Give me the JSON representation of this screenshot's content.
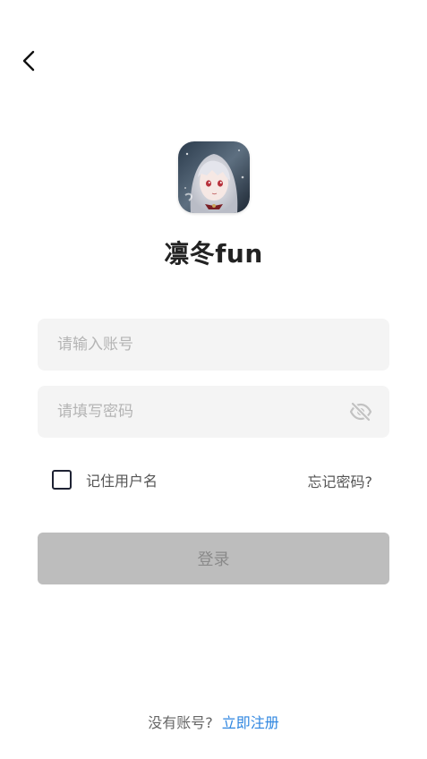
{
  "app": {
    "name": "凛冬fun"
  },
  "form": {
    "account_placeholder": "请输入账号",
    "account_value": "",
    "password_placeholder": "请填写密码",
    "password_value": "",
    "remember_label": "记住用户名",
    "remember_checked": false,
    "forgot_label": "忘记密码?",
    "login_label": "登录"
  },
  "footer": {
    "prompt": "没有账号?",
    "register_label": "立即注册"
  },
  "icons": {
    "back": "chevron-left-icon",
    "password_visibility": "eye-off-icon"
  },
  "colors": {
    "link": "#2f86e0",
    "button_disabled": "#bdbdbd",
    "input_bg": "#f4f4f4"
  }
}
